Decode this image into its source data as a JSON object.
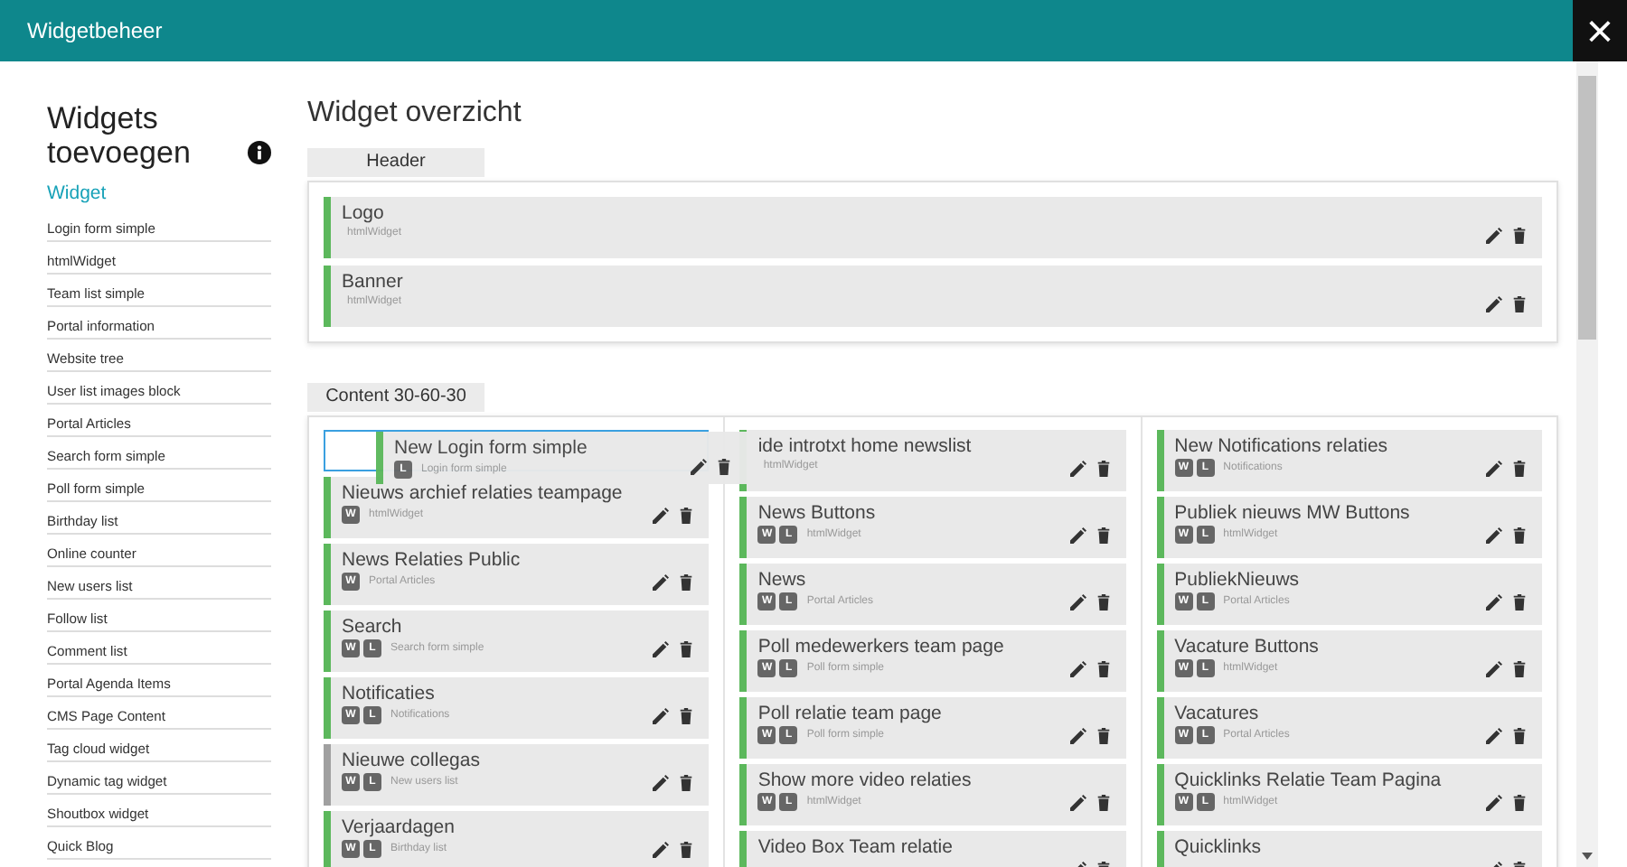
{
  "window": {
    "title": "Widgetbeheer",
    "close": "×"
  },
  "sidebar": {
    "title": "Widgets toevoegen",
    "subtitle": "Widget",
    "items": [
      "Login form simple",
      "htmlWidget",
      "Team list simple",
      "Portal information",
      "Website tree",
      "User list images block",
      "Portal Articles",
      "Search form simple",
      "Poll form simple",
      "Birthday list",
      "Online counter",
      "New users list",
      "Follow list",
      "Comment list",
      "Portal Agenda Items",
      "CMS Page Content",
      "Tag cloud widget",
      "Dynamic tag widget",
      "Shoutbox widget",
      "Quick Blog"
    ]
  },
  "overview": {
    "title": "Widget overzicht",
    "sections": [
      {
        "name": "Header",
        "columns": [
          [
            {
              "kind": "widget",
              "title": "Logo",
              "type": "htmlWidget",
              "color": "#5cb85c"
            },
            {
              "kind": "widget",
              "title": "Banner",
              "type": "htmlWidget",
              "color": "#5cb85c"
            }
          ]
        ]
      },
      {
        "name": "Content 30-60-30",
        "columns": [
          [
            {
              "kind": "placeholder"
            },
            {
              "kind": "widget",
              "title": "Nieuws archief relaties teampage",
              "type": "htmlWidget",
              "badges": [
                "W"
              ],
              "color": "#5cb85c"
            },
            {
              "kind": "widget",
              "title": "News Relaties Public",
              "type": "Portal Articles",
              "badges": [
                "W"
              ],
              "color": "#5cb85c"
            },
            {
              "kind": "widget",
              "title": "Search",
              "type": "Search form simple",
              "badges": [
                "W",
                "L"
              ],
              "color": "#5cb85c"
            },
            {
              "kind": "widget",
              "title": "Notificaties",
              "type": "Notifications",
              "badges": [
                "W",
                "L"
              ],
              "color": "#5cb85c"
            },
            {
              "kind": "widget",
              "title": "Nieuwe collegas",
              "type": "New users list",
              "badges": [
                "W",
                "L"
              ],
              "color": "#a0a0a0"
            },
            {
              "kind": "widget",
              "title": "Verjaardagen",
              "type": "Birthday list",
              "badges": [
                "W",
                "L"
              ],
              "color": "#5cb85c"
            }
          ],
          [
            {
              "kind": "widget",
              "title": "ide introtxt home newslist",
              "type": "htmlWidget",
              "color": "#5cb85c"
            },
            {
              "kind": "widget",
              "title": "News Buttons",
              "type": "htmlWidget",
              "badges": [
                "W",
                "L"
              ],
              "color": "#5cb85c"
            },
            {
              "kind": "widget",
              "title": "News",
              "type": "Portal Articles",
              "badges": [
                "W",
                "L"
              ],
              "color": "#5cb85c"
            },
            {
              "kind": "widget",
              "title": "Poll medewerkers team page",
              "type": "Poll form simple",
              "badges": [
                "W",
                "L"
              ],
              "color": "#5cb85c"
            },
            {
              "kind": "widget",
              "title": "Poll relatie team page",
              "type": "Poll form simple",
              "badges": [
                "W",
                "L"
              ],
              "color": "#5cb85c"
            },
            {
              "kind": "widget",
              "title": "Show more video relaties",
              "type": "htmlWidget",
              "badges": [
                "W",
                "L"
              ],
              "color": "#5cb85c"
            },
            {
              "kind": "widget",
              "title": "Video Box Team relatie",
              "color": "#5cb85c"
            }
          ],
          [
            {
              "kind": "widget",
              "title": "New Notifications relaties",
              "type": "Notifications",
              "badges": [
                "W",
                "L"
              ],
              "color": "#5cb85c"
            },
            {
              "kind": "widget",
              "title": "Publiek nieuws MW Buttons",
              "type": "htmlWidget",
              "badges": [
                "W",
                "L"
              ],
              "color": "#5cb85c"
            },
            {
              "kind": "widget",
              "title": "PubliekNieuws",
              "type": "Portal Articles",
              "badges": [
                "W",
                "L"
              ],
              "color": "#5cb85c"
            },
            {
              "kind": "widget",
              "title": "Vacature Buttons",
              "type": "htmlWidget",
              "badges": [
                "W",
                "L"
              ],
              "color": "#5cb85c"
            },
            {
              "kind": "widget",
              "title": "Vacatures",
              "type": "Portal Articles",
              "badges": [
                "W",
                "L"
              ],
              "color": "#5cb85c"
            },
            {
              "kind": "widget",
              "title": "Quicklinks Relatie Team Pagina",
              "type": "htmlWidget",
              "badges": [
                "W",
                "L"
              ],
              "color": "#5cb85c"
            },
            {
              "kind": "widget",
              "title": "Quicklinks",
              "color": "#5cb85c"
            }
          ]
        ],
        "dragging": {
          "title": "New Login form simple",
          "type": "Login form simple",
          "badges": [
            "L"
          ],
          "color": "#5cb85c"
        }
      }
    ]
  }
}
